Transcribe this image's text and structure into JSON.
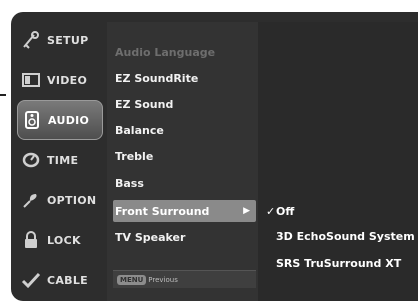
{
  "sidebar": {
    "items": [
      {
        "label": "SETUP",
        "icon": "setup-icon"
      },
      {
        "label": "VIDEO",
        "icon": "video-icon"
      },
      {
        "label": "AUDIO",
        "icon": "audio-icon",
        "active": true
      },
      {
        "label": "TIME",
        "icon": "time-icon"
      },
      {
        "label": "OPTION",
        "icon": "option-icon"
      },
      {
        "label": "LOCK",
        "icon": "lock-icon"
      },
      {
        "label": "CABLE",
        "icon": "cable-icon"
      }
    ]
  },
  "audio_menu": {
    "options": [
      {
        "label": "Audio Language",
        "enabled": false
      },
      {
        "label": "EZ SoundRite"
      },
      {
        "label": "EZ Sound"
      },
      {
        "label": "Balance"
      },
      {
        "label": "Treble"
      },
      {
        "label": "Bass"
      },
      {
        "label": "Front Surround",
        "selected": true
      },
      {
        "label": "TV Speaker"
      }
    ],
    "submenu_arrow": "▶"
  },
  "front_surround_submenu": {
    "options": [
      {
        "label": "Off",
        "checked": true,
        "check_glyph": "✓"
      },
      {
        "label": "3D EchoSound System"
      },
      {
        "label": "SRS TruSurround XT"
      }
    ]
  },
  "footer": {
    "key_label": "MENU",
    "action_label": "Previous"
  },
  "colors": {
    "menu_bg": "#2d2d2d",
    "highlight": "#8a8a8a",
    "disabled_text": "#6e6e6e"
  }
}
